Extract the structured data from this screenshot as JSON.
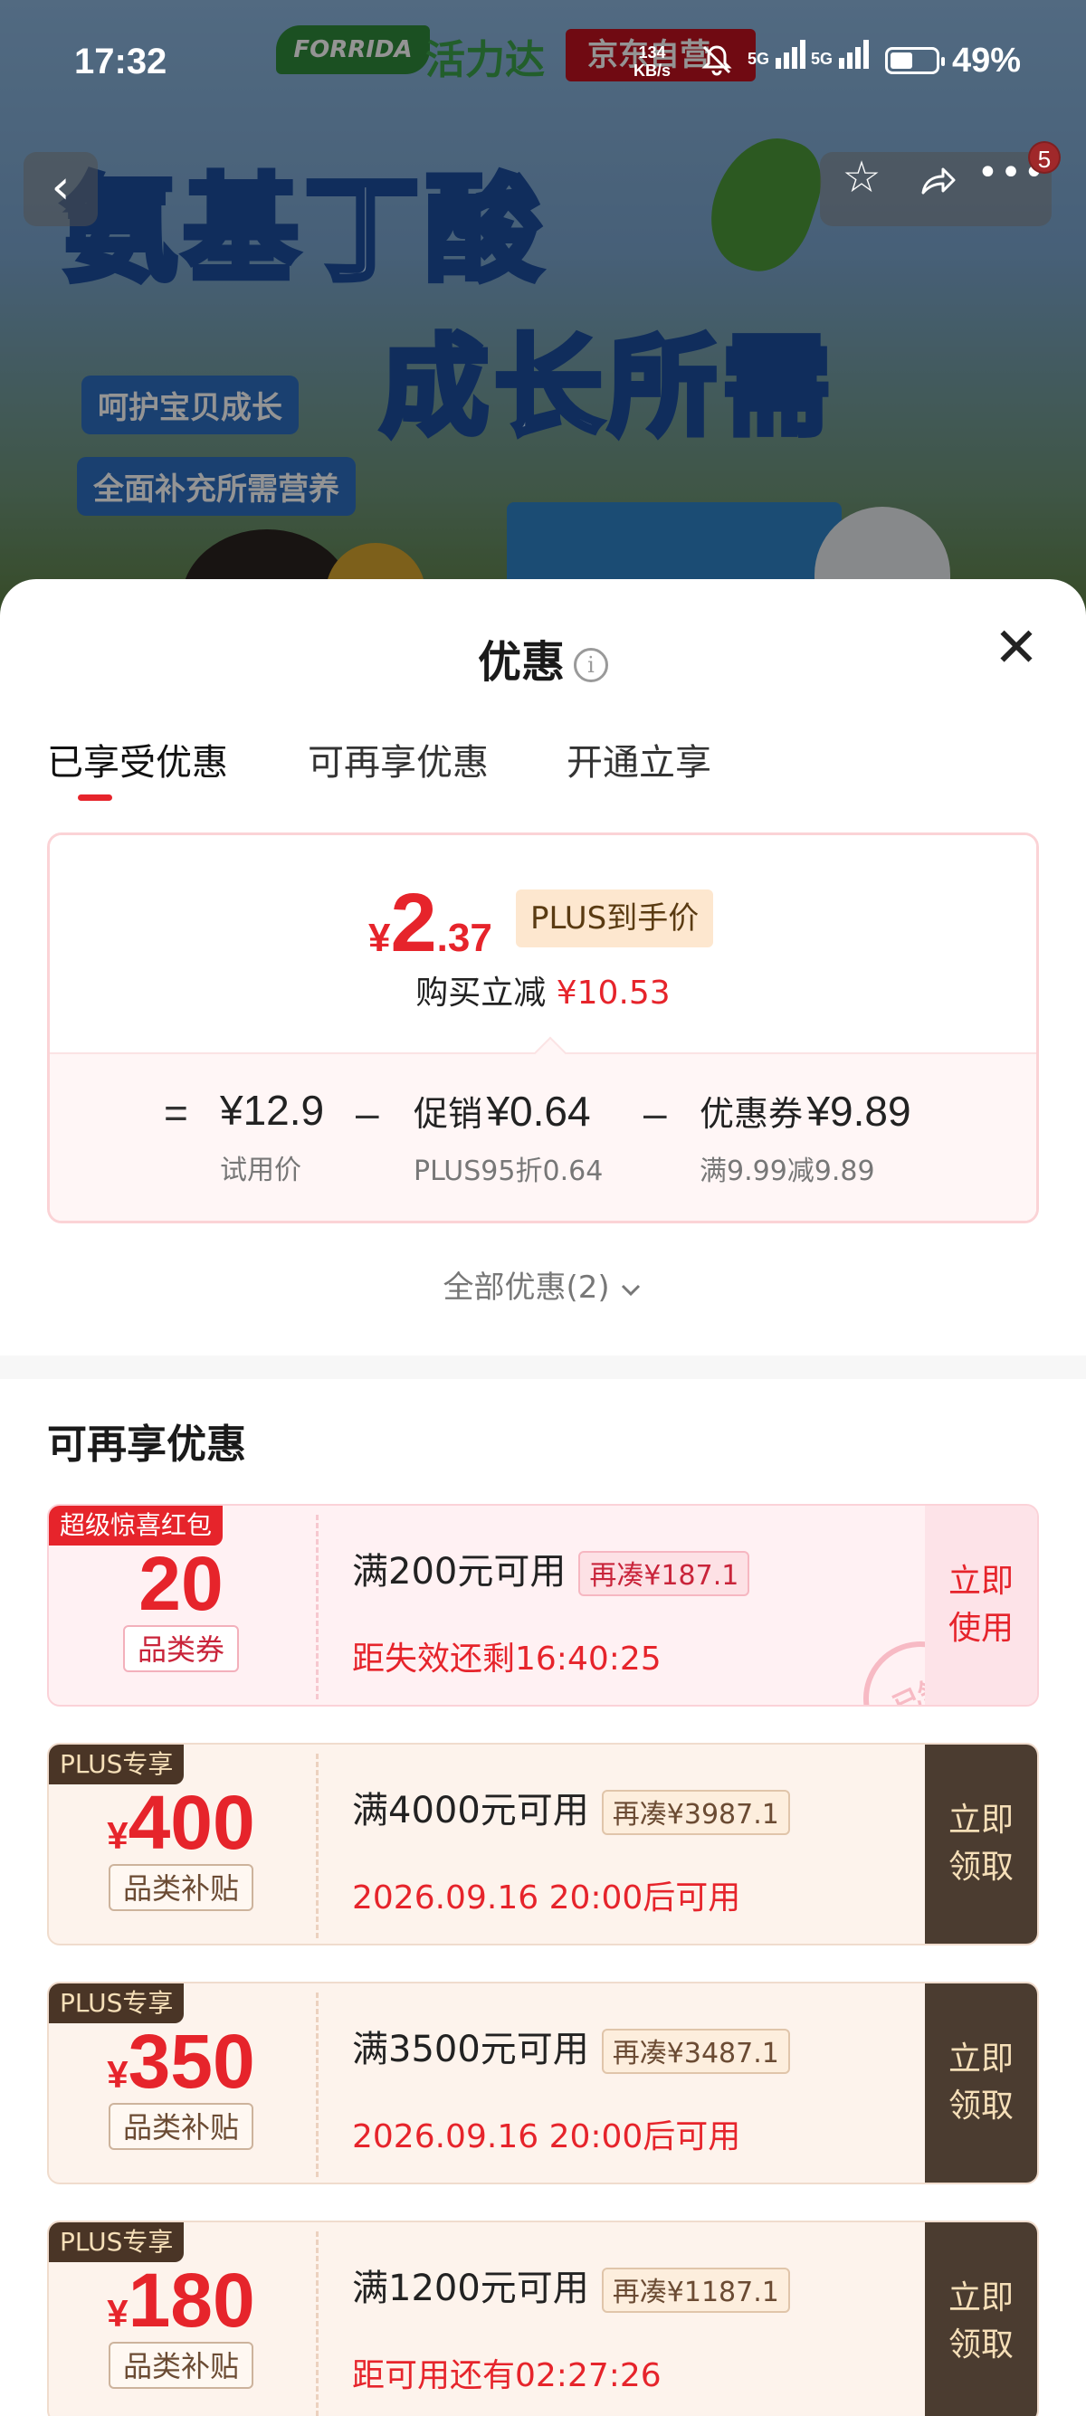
{
  "status_bar": {
    "time": "17:32",
    "net_speed_value": "134",
    "net_speed_unit": "KB/s",
    "sim1": "5G",
    "sim2": "5G",
    "battery_level": 0.49,
    "battery_pct": "49%"
  },
  "banner": {
    "brand_logo": "FORRIDA",
    "brand_name": "活力达",
    "store_tag": "京东自营",
    "headline_1": "氨基丁酸",
    "headline_2": "成长所需",
    "pill_1": "呵护宝贝成长",
    "pill_2": "全面补充所需营养"
  },
  "nav": {
    "back_icon": "chevron-left-icon",
    "favorite_icon": "star-icon",
    "share_icon": "share-icon",
    "more_icon": "more-icon",
    "badge_count": "5"
  },
  "sheet": {
    "title": "优惠",
    "close_label": "✕",
    "tabs": [
      {
        "label": "已享受优惠"
      },
      {
        "label": "可再享优惠"
      },
      {
        "label": "开通立享"
      }
    ]
  },
  "price_card": {
    "currency": "¥",
    "final_int": "2",
    "final_dec": ".37",
    "final_tag": "PLUS到手价",
    "instant_off_label": "购买立减",
    "instant_off_amount": "¥10.53",
    "eq_symbol": "=",
    "minus_symbol": "–",
    "trial_price": "¥12.9",
    "trial_label": "试用价",
    "promo_label": "促销",
    "promo_amount": "¥0.64",
    "promo_sub": "PLUS95折0.64",
    "coupon_label": "优惠券",
    "coupon_amount": "¥9.89",
    "coupon_sub": "满9.99减9.89"
  },
  "all_discounts": "全部优惠(2)",
  "section": {
    "title": "可再享优惠"
  },
  "coupons": [
    {
      "tag": "超级惊喜红包",
      "currency": "",
      "amount": "20",
      "kind": "品类券",
      "condition": "满200元可用",
      "need": "再凑¥187.1",
      "time": "距失效还剩16:40:25",
      "action": "立即使用",
      "stamp": "已领"
    },
    {
      "tag": "PLUS专享",
      "currency": "¥",
      "amount": "400",
      "kind": "品类补贴",
      "condition": "满4000元可用",
      "need": "再凑¥3987.1",
      "time": "2026.09.16 20:00后可用",
      "action": "立即领取"
    },
    {
      "tag": "PLUS专享",
      "currency": "¥",
      "amount": "350",
      "kind": "品类补贴",
      "condition": "满3500元可用",
      "need": "再凑¥3487.1",
      "time": "2026.09.16 20:00后可用",
      "action": "立即领取"
    },
    {
      "tag": "PLUS专享",
      "currency": "¥",
      "amount": "180",
      "kind": "品类补贴",
      "condition": "满1200元可用",
      "need": "再凑¥1187.1",
      "time": "距可用还有02:27:26",
      "action": "立即领取"
    }
  ],
  "colors": {
    "accent_red": "#e6242b",
    "plus_dark": "#4b3c30",
    "plus_gold": "#f6dfb8"
  }
}
